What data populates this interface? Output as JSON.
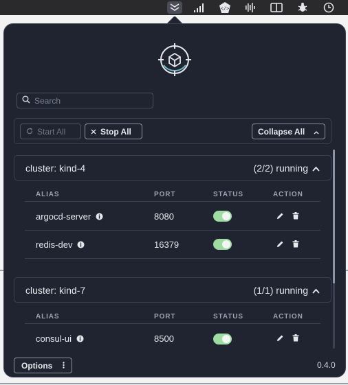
{
  "menubar": {
    "icons": [
      "kubefwd-icon",
      "signal-bars-icon",
      "code-badge-icon",
      "audio-wave-icon",
      "split-view-icon",
      "bug-icon",
      "clock-icon"
    ]
  },
  "search": {
    "placeholder": "Search",
    "value": ""
  },
  "toolbar": {
    "start_all": "Start All",
    "stop_all": "Stop All",
    "collapse_all": "Collapse All"
  },
  "table_headers": {
    "alias": "ALIAS",
    "port": "PORT",
    "status": "STATUS",
    "action": "ACTION"
  },
  "clusters": [
    {
      "name": "cluster: kind-4",
      "status": "(2/2) running",
      "services": [
        {
          "alias": "argocd-server",
          "port": "8080",
          "enabled": true
        },
        {
          "alias": "redis-dev",
          "port": "16379",
          "enabled": true
        }
      ]
    },
    {
      "name": "cluster: kind-7",
      "status": "(1/1) running",
      "services": [
        {
          "alias": "consul-ui",
          "port": "8500",
          "enabled": true
        }
      ]
    }
  ],
  "footer": {
    "options": "Options",
    "version": "0.4.0"
  },
  "colors": {
    "toggle_on": "#9fdca4",
    "panel_bg": "#1f2430",
    "border": "#3b4152"
  }
}
